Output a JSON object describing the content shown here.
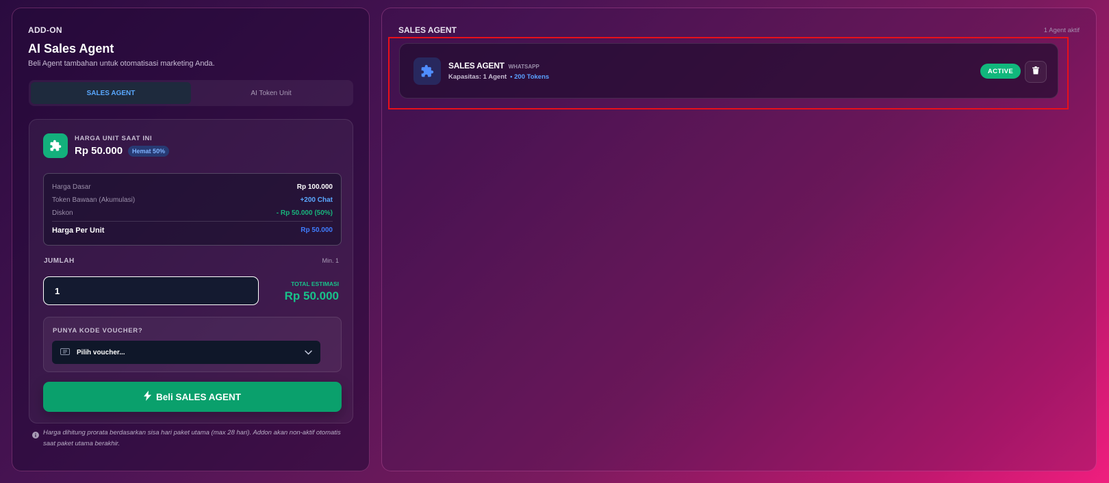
{
  "left": {
    "kicker": "ADD-ON",
    "title": "AI Sales Agent",
    "subtitle": "Beli Agent tambahan untuk otomatisasi marketing Anda.",
    "tabs": [
      {
        "label": "SALES AGENT",
        "active": true
      },
      {
        "label": "AI Token Unit",
        "active": false
      }
    ],
    "price": {
      "label": "HARGA UNIT SAAT INI",
      "value": "Rp 50.000",
      "badge": "Hemat 50%"
    },
    "breakdown": [
      {
        "key": "Harga Dasar",
        "value": "Rp 100.000",
        "color": "#ffffff"
      },
      {
        "key": "Token Bawaan (Akumulasi)",
        "value": "+200 Chat",
        "color": "#5aa8ff"
      },
      {
        "key": "Diskon",
        "value": "- Rp 50.000 (50%)",
        "color": "#18b47c"
      }
    ],
    "per_unit": {
      "key": "Harga Per Unit",
      "value": "Rp 50.000",
      "color": "#3f7dff"
    },
    "quantity": {
      "label": "JUMLAH",
      "min": "Min. 1",
      "value": "1"
    },
    "estimate": {
      "label": "TOTAL ESTIMASI",
      "value": "Rp 50.000"
    },
    "voucher": {
      "label": "PUNYA KODE VOUCHER?",
      "placeholder": "Pilih voucher..."
    },
    "buy_button": "Beli SALES AGENT",
    "footnote": "Harga dihitung prorata berdasarkan sisa hari paket utama (max 28 hari). Addon akan non-aktif otomatis saat paket utama berakhir."
  },
  "right": {
    "title": "SALES AGENT",
    "count": "1 Agent aktif",
    "agents": [
      {
        "name": "SALES AGENT",
        "platform": "WHATSAPP",
        "capacity": "Kapasitas: 1 Agent",
        "tokens": "• 200 Tokens",
        "status": "ACTIVE"
      }
    ]
  },
  "colors": {
    "accent_green": "#0aa06c",
    "highlight_red": "#e8101a",
    "link_blue": "#5aa8ff"
  }
}
